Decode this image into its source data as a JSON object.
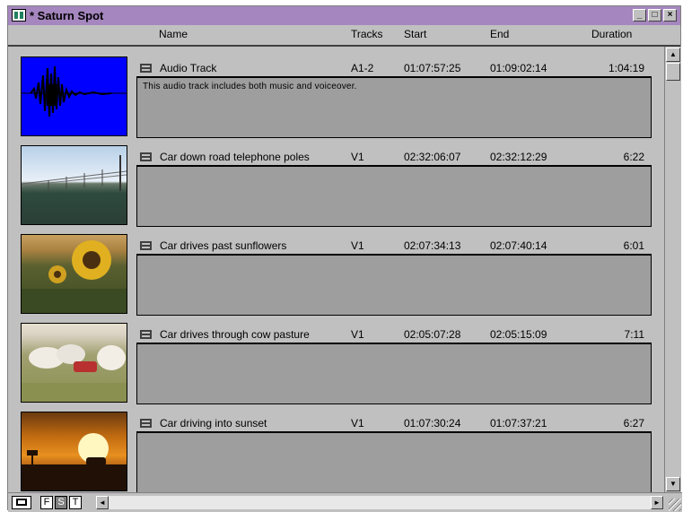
{
  "window": {
    "title": "* Saturn Spot"
  },
  "titlebar_buttons": {
    "minimize": "_",
    "maximize": "□",
    "close": "×"
  },
  "columns": {
    "name": "Name",
    "tracks": "Tracks",
    "start": "Start",
    "end": "End",
    "duration": "Duration"
  },
  "clips": [
    {
      "name": "Audio Track",
      "tracks": "A1-2",
      "start": "01:07:57:25",
      "end": "01:09:02:14",
      "duration": "1:04:19",
      "notes": "This audio track includes both music and voiceover.",
      "thumbnail": "audio-waveform"
    },
    {
      "name": "Car down road telephone poles",
      "tracks": "V1",
      "start": "02:32:06:07",
      "end": "02:32:12:29",
      "duration": "6:22",
      "notes": "",
      "thumbnail": "telephone-poles"
    },
    {
      "name": "Car drives past sunflowers",
      "tracks": "V1",
      "start": "02:07:34:13",
      "end": "02:07:40:14",
      "duration": "6:01",
      "notes": "",
      "thumbnail": "sunflowers"
    },
    {
      "name": "Car drives through cow pasture",
      "tracks": "V1",
      "start": "02:05:07:28",
      "end": "02:05:15:09",
      "duration": "7:11",
      "notes": "",
      "thumbnail": "cow-pasture"
    },
    {
      "name": "Car driving into sunset",
      "tracks": "V1",
      "start": "01:07:30:24",
      "end": "01:07:37:21",
      "duration": "6:27",
      "notes": "",
      "thumbnail": "sunset"
    }
  ],
  "view_buttons": {
    "frame": "F",
    "script": "S",
    "text": "T"
  },
  "scroll": {
    "up": "▲",
    "down": "▼",
    "left": "◄",
    "right": "►"
  }
}
